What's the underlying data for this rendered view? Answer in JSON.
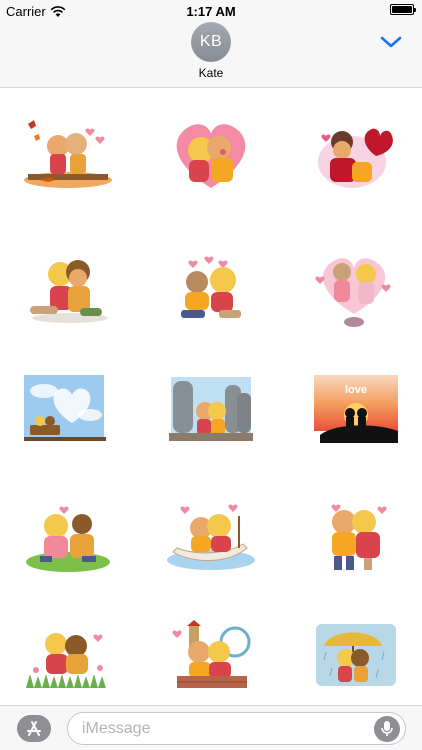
{
  "status_bar": {
    "carrier": "Carrier",
    "time": "1:17 AM",
    "wifi_icon": "wifi-icon",
    "battery_icon": "battery-icon"
  },
  "header": {
    "avatar_initials": "KB",
    "contact_name": "Kate",
    "collapse_icon": "chevron-down-icon",
    "accent_color": "#1a73e8"
  },
  "stickers": [
    {
      "name": "sticker-autumn-kiss"
    },
    {
      "name": "sticker-heart-kiss"
    },
    {
      "name": "sticker-red-heart-hug"
    },
    {
      "name": "sticker-sitting-hug"
    },
    {
      "name": "sticker-hearts-cuddle"
    },
    {
      "name": "sticker-heart-balloon"
    },
    {
      "name": "sticker-sky-heart-bench"
    },
    {
      "name": "sticker-stone-statues"
    },
    {
      "name": "sticker-love-sunset"
    },
    {
      "name": "sticker-grass-hug"
    },
    {
      "name": "sticker-boat-kiss"
    },
    {
      "name": "sticker-standing-kiss"
    },
    {
      "name": "sticker-garden-hug"
    },
    {
      "name": "sticker-city-kiss"
    },
    {
      "name": "sticker-umbrella-rain"
    }
  ],
  "sunset_text": "love",
  "compose": {
    "placeholder": "iMessage",
    "value": "",
    "app_store_icon": "app-store-icon",
    "mic_icon": "microphone-icon",
    "button_color": "#8e8e93"
  }
}
